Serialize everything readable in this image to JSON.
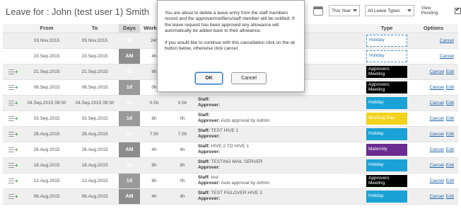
{
  "page_title": "Leave for : John (test user 1) Smith",
  "filters": {
    "year": "This Year",
    "leave_type": "All Leave Types",
    "view_pending": "View Pending"
  },
  "columns": {
    "from": "From",
    "to": "To",
    "days": "Days",
    "working": "Working",
    "type": "Type",
    "options": "Options"
  },
  "rows": [
    {
      "icon": false,
      "from": "03.Nov.2015",
      "to": "05.Nov.2015",
      "days": "3d",
      "working": "24h",
      "other": "",
      "staff": "",
      "approver": "",
      "type": "Holiday",
      "type_style": "holiday-o",
      "edit": false,
      "highlight": true
    },
    {
      "icon": false,
      "from": "23.Sep.2015",
      "to": "23.Sep.2015",
      "days": "AM",
      "working": "4h",
      "other": "",
      "staff": "",
      "approver": "",
      "type": "Holiday",
      "type_style": "holiday-o",
      "edit": false,
      "highlight": false
    },
    {
      "icon": true,
      "from": "21.Sep.2015",
      "to": "21.Sep.2015",
      "days": "1d",
      "working": "8h",
      "other": "",
      "staff": "",
      "approver": "",
      "type": "Approvers Meeting",
      "type_style": "approvers",
      "edit": true,
      "highlight": true
    },
    {
      "icon": true,
      "from": "06.Sep.2015",
      "to": "06.Sep.2015",
      "days": "1d",
      "working": "0h",
      "other": "",
      "staff": "",
      "approver": "",
      "type": "Approvers Meeting",
      "type_style": "approvers",
      "edit": true,
      "highlight": false
    },
    {
      "icon": true,
      "from": "04.Sep.2015 09:00",
      "to": "04.Sep.2015 09:30",
      "days": "1d",
      "working": "0.5h",
      "other": "0.5h",
      "staff": "Staff:",
      "approver": "Approver:",
      "type": "Holiday",
      "type_style": "holiday",
      "edit": true,
      "highlight": true
    },
    {
      "icon": true,
      "from": "03.Sep.2015",
      "to": "03.Sep.2015",
      "days": "1d",
      "working": "8h",
      "other": "0h",
      "staff": "Staff:",
      "approver": "Approver: Auto approval by Admin",
      "type": "Working Day",
      "type_style": "working",
      "edit": true,
      "highlight": false
    },
    {
      "icon": true,
      "from": "28.Aug.2015",
      "to": "28.Aug.2015",
      "days": "1d",
      "working": "7.5h",
      "other": "7.5h",
      "staff": "Staff: TEST HIVE 1",
      "approver": "Approver:",
      "type": "Holiday",
      "type_style": "holiday",
      "edit": true,
      "highlight": true
    },
    {
      "icon": true,
      "from": "26.Aug.2015",
      "to": "26.Aug.2015",
      "days": "AM",
      "working": "4h",
      "other": "4h",
      "staff": "Staff: HIVE 2 TO HIVE 1",
      "approver": "Approver:",
      "type": "Maternity",
      "type_style": "maternity",
      "edit": true,
      "highlight": false
    },
    {
      "icon": true,
      "from": "18.Aug.2015",
      "to": "18.Aug.2015",
      "days": "1d",
      "working": "8h",
      "other": "8h",
      "staff": "Staff: TESTING MAIL SERVER",
      "approver": "Approver:",
      "type": "Holiday",
      "type_style": "holiday",
      "edit": true,
      "highlight": true
    },
    {
      "icon": true,
      "from": "12.Aug.2015",
      "to": "12.Aug.2015",
      "days": "1d",
      "working": "8h",
      "other": "0h",
      "staff": "Staff: test",
      "approver": "Approver: Auto approval by Admin",
      "type": "Approvers Meeting",
      "type_style": "approvers",
      "edit": true,
      "highlight": false
    },
    {
      "icon": true,
      "from": "06.Aug.2015",
      "to": "06.Aug.2015",
      "days": "AM",
      "working": "4h",
      "other": "4h",
      "staff": "Staff: TEST FAILOVER HIVE 2",
      "approver": "Approver:",
      "type": "Holiday",
      "type_style": "holiday",
      "edit": true,
      "highlight": true
    }
  ],
  "option_labels": {
    "cancel": "Cancel",
    "edit": "Edit"
  },
  "dialog": {
    "text1": "You are about to delete a leave entry from the staff members record and the approver/notifiers/staff member will be notified. If the leave request has been approved any allowance will automatically be added back to their allowance.",
    "text2": "If you would like to continue with this cancellation click on the ok button below, otherwise click cancel.",
    "ok": "OK",
    "cancel": "Cancel"
  }
}
